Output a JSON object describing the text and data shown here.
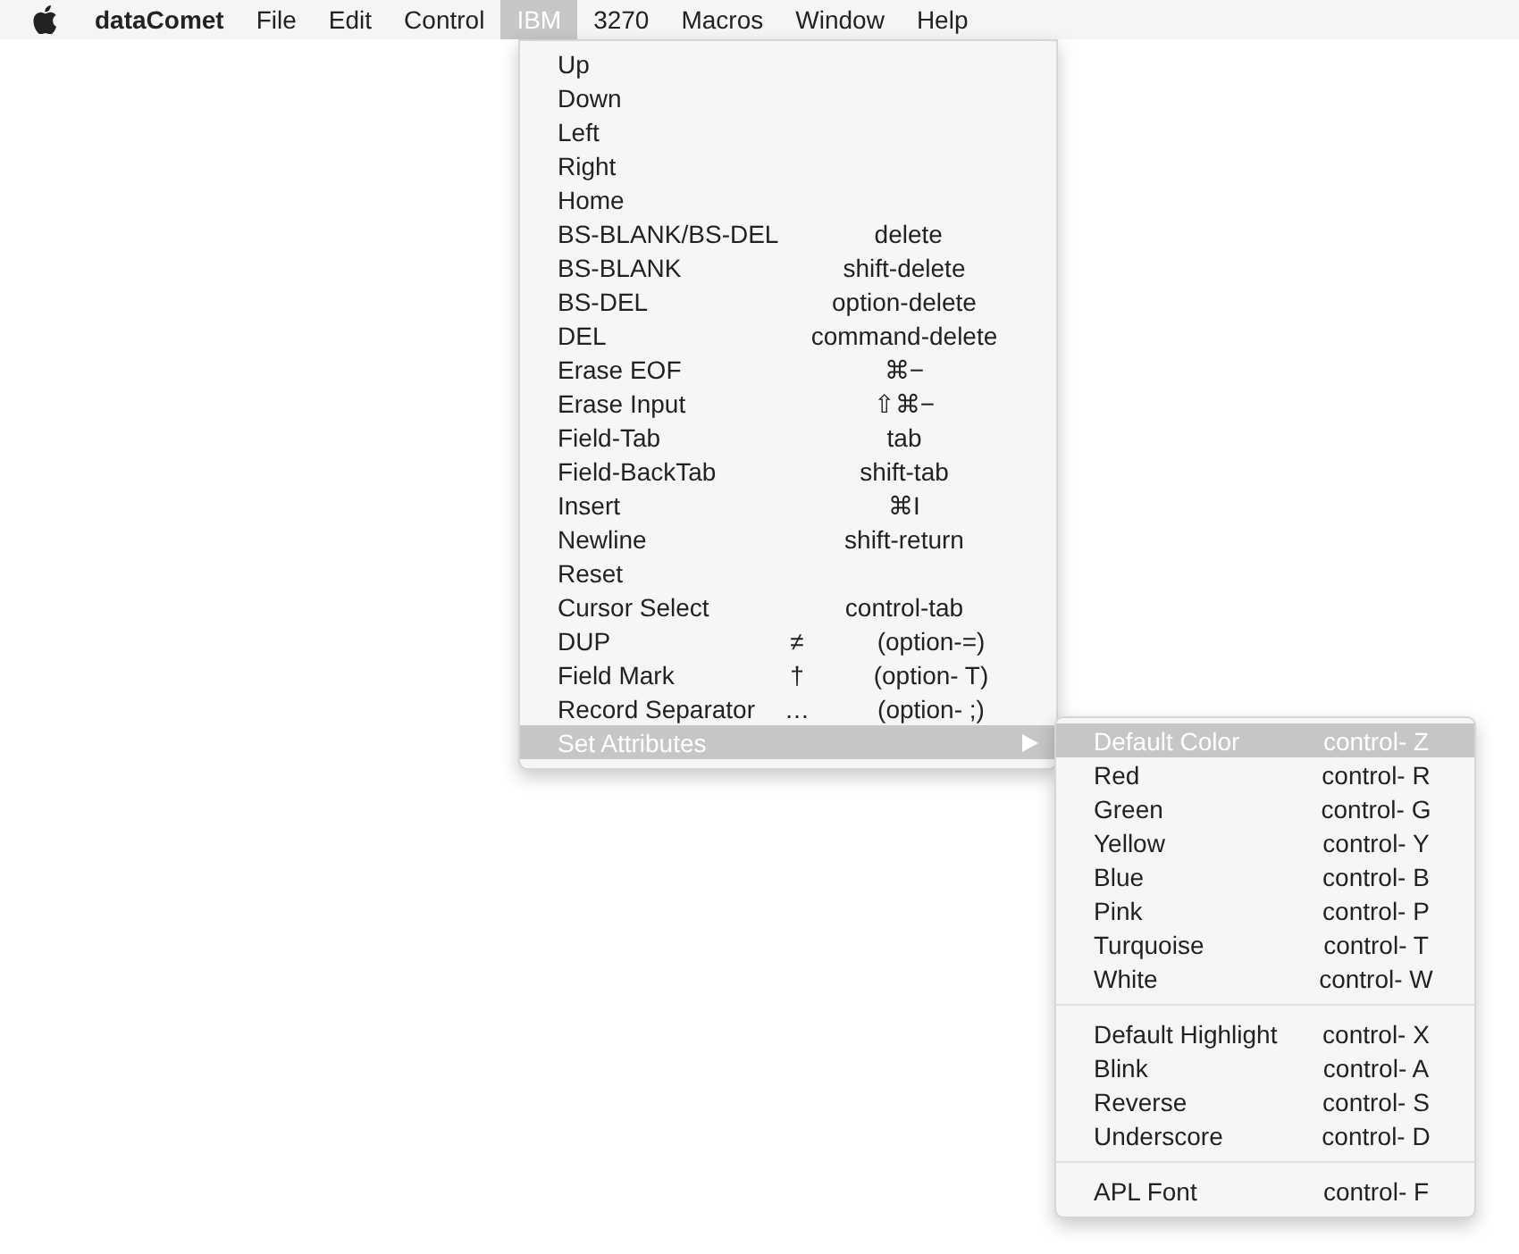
{
  "menubar": {
    "app": "dataComet",
    "items": [
      {
        "label": "File",
        "selected": false
      },
      {
        "label": "Edit",
        "selected": false
      },
      {
        "label": "Control",
        "selected": false
      },
      {
        "label": "IBM",
        "selected": true
      },
      {
        "label": "3270",
        "selected": false
      },
      {
        "label": "Macros",
        "selected": false
      },
      {
        "label": "Window",
        "selected": false
      },
      {
        "label": "Help",
        "selected": false
      }
    ]
  },
  "menu": {
    "items": [
      {
        "label": "Up",
        "selected": false
      },
      {
        "label": "Down",
        "selected": false
      },
      {
        "label": "Left",
        "selected": false
      },
      {
        "label": "Right",
        "selected": false
      },
      {
        "label": "Home",
        "selected": false
      },
      {
        "label": "BS-BLANK/BS-DEL",
        "shortcut": "delete",
        "selected": false
      },
      {
        "label": "BS-BLANK",
        "shortcut": "shift-delete",
        "selected": false
      },
      {
        "label": "BS-DEL",
        "shortcut": "option-delete",
        "selected": false
      },
      {
        "label": "DEL",
        "shortcut": "command-delete",
        "selected": false
      },
      {
        "label": "Erase EOF",
        "shortcut": "⌘−",
        "selected": false
      },
      {
        "label": "Erase Input",
        "shortcut": "⇧⌘−",
        "selected": false
      },
      {
        "label": "Field-Tab",
        "shortcut": "tab",
        "selected": false
      },
      {
        "label": "Field-BackTab",
        "shortcut": "shift-tab",
        "selected": false
      },
      {
        "label": "Insert",
        "shortcut": "⌘I",
        "selected": false
      },
      {
        "label": "Newline",
        "shortcut": "shift-return",
        "selected": false
      },
      {
        "label": "Reset",
        "selected": false
      },
      {
        "label": "Cursor Select",
        "shortcut": "control-tab",
        "selected": false
      },
      {
        "label": "DUP",
        "glyph": "≠",
        "shortcut": "(option-=)",
        "selected": false
      },
      {
        "label": "Field Mark",
        "glyph": "†",
        "shortcut": "(option- T)",
        "selected": false
      },
      {
        "label": "Record Separator",
        "glyph": "…",
        "shortcut": "(option- ;)",
        "selected": false
      },
      {
        "label": "Set Attributes",
        "has_submenu": true,
        "selected": true
      }
    ]
  },
  "submenu": {
    "groups": [
      [
        {
          "label": "Default Color",
          "shortcut": "control- Z",
          "selected": true
        },
        {
          "label": "Red",
          "shortcut": "control- R",
          "selected": false
        },
        {
          "label": "Green",
          "shortcut": "control- G",
          "selected": false
        },
        {
          "label": "Yellow",
          "shortcut": "control- Y",
          "selected": false
        },
        {
          "label": "Blue",
          "shortcut": "control- B",
          "selected": false
        },
        {
          "label": "Pink",
          "shortcut": "control- P",
          "selected": false
        },
        {
          "label": "Turquoise",
          "shortcut": "control- T",
          "selected": false
        },
        {
          "label": "White",
          "shortcut": "control- W",
          "selected": false
        }
      ],
      [
        {
          "label": "Default Highlight",
          "shortcut": "control- X",
          "selected": false
        },
        {
          "label": "Blink",
          "shortcut": "control- A",
          "selected": false
        },
        {
          "label": "Reverse",
          "shortcut": "control- S",
          "selected": false
        },
        {
          "label": "Underscore",
          "shortcut": "control- D",
          "selected": false
        }
      ],
      [
        {
          "label": "APL Font",
          "shortcut": "control- F",
          "selected": false
        }
      ]
    ]
  }
}
